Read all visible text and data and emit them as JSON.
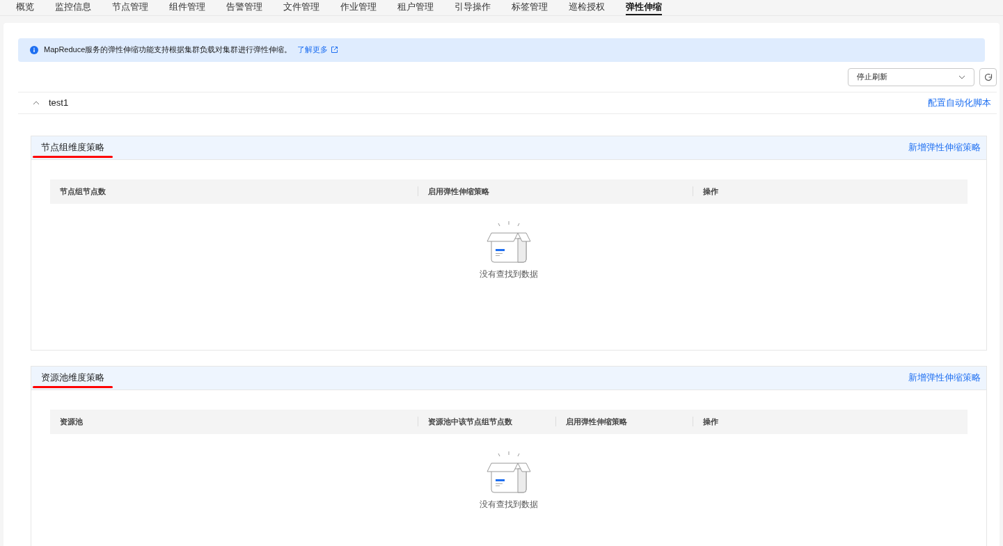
{
  "tabs": [
    {
      "label": "概览",
      "selected": false
    },
    {
      "label": "监控信息",
      "selected": false
    },
    {
      "label": "节点管理",
      "selected": false
    },
    {
      "label": "组件管理",
      "selected": false
    },
    {
      "label": "告警管理",
      "selected": false
    },
    {
      "label": "文件管理",
      "selected": false
    },
    {
      "label": "作业管理",
      "selected": false
    },
    {
      "label": "租户管理",
      "selected": false
    },
    {
      "label": "引导操作",
      "selected": false
    },
    {
      "label": "标签管理",
      "selected": false
    },
    {
      "label": "巡检授权",
      "selected": false
    },
    {
      "label": "弹性伸缩",
      "selected": true
    }
  ],
  "notice": {
    "text": "MapReduce服务的弹性伸缩功能支持根据集群负载对集群进行弹性伸缩。",
    "link": "了解更多"
  },
  "refresh_select": {
    "value": "停止刷新"
  },
  "cluster": {
    "name": "test1",
    "expanded": true,
    "action": "配置自动化脚本"
  },
  "sections": [
    {
      "title": "节点组维度策略",
      "action": "新增弹性伸缩策略",
      "columns": [
        "节点组节点数",
        "启用弹性伸缩策略",
        "操作"
      ],
      "empty_text": "没有查找到数据"
    },
    {
      "title": "资源池维度策略",
      "action": "新增弹性伸缩策略",
      "columns": [
        "资源池",
        "资源池中该节点组节点数",
        "启用弹性伸缩策略",
        "操作"
      ],
      "empty_text": "没有查找到数据"
    }
  ]
}
